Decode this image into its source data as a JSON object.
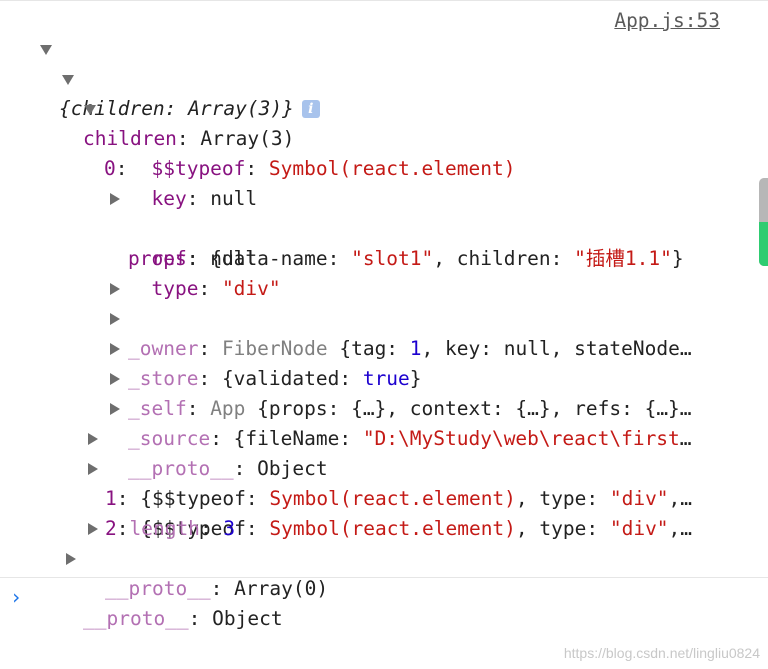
{
  "source_link": "App.js:53",
  "root": {
    "brace_open": "{",
    "key": "children",
    "sep": ": ",
    "value": "Array(3)",
    "brace_close": "}",
    "info_icon": "i"
  },
  "children_row": {
    "key": "children",
    "sep": ": ",
    "value": "Array(3)"
  },
  "item0": {
    "key": "0",
    "sep": ":"
  },
  "typeof_row": {
    "key": "$$typeof",
    "sep": ": ",
    "value": "Symbol(react.element)"
  },
  "key_row": {
    "key": "key",
    "sep": ": ",
    "value": "null"
  },
  "props_row": {
    "key": "props",
    "sep": ": ",
    "p1": "{data-name: ",
    "v1": "\"slot1\"",
    "p2": ", children: ",
    "v2": "\"插槽1.1\"",
    "p3": "}"
  },
  "ref_row": {
    "key": "ref",
    "sep": ": ",
    "value": "null"
  },
  "type_row": {
    "key": "type",
    "sep": ": ",
    "value": "\"div\""
  },
  "owner_row": {
    "key": "_owner",
    "sep": ": ",
    "cls": "FiberNode ",
    "p1": "{tag: ",
    "v1": "1",
    "p2": ", key: null, stateNode",
    "ell": "…"
  },
  "store_row": {
    "key": "_store",
    "sep": ": ",
    "p1": "{validated: ",
    "v1": "true",
    "p2": "}"
  },
  "self_row": {
    "key": "_self",
    "sep": ": ",
    "cls": "App ",
    "p1": "{props: {…}, context: {…}, refs: {…}",
    "ell": "…"
  },
  "source_row": {
    "key": "_source",
    "sep": ": ",
    "p1": "{fileName: ",
    "v1": "\"D:\\MyStudy\\web\\react\\first",
    "ell": "…"
  },
  "proto_obj_row": {
    "key": "__proto__",
    "sep": ": ",
    "value": "Object"
  },
  "item1": {
    "key": "1",
    "sep": ": ",
    "p1": "{$$typeof: ",
    "v1": "Symbol(react.element)",
    "p2": ", type: ",
    "v2": "\"div\"",
    "p3": ",",
    "ell": "…"
  },
  "item2": {
    "key": "2",
    "sep": ": ",
    "p1": "{$$typeof: ",
    "v1": "Symbol(react.element)",
    "p2": ", type: ",
    "v2": "\"div\"",
    "p3": ",",
    "ell": "…"
  },
  "length_row": {
    "key": "length",
    "sep": ": ",
    "value": "3"
  },
  "proto_arr_row": {
    "key": "__proto__",
    "sep": ": ",
    "value": "Array(0)"
  },
  "proto_root_row": {
    "key": "__proto__",
    "sep": ": ",
    "value": "Object"
  },
  "prompt_symbol": "›",
  "watermark": "https://blog.csdn.net/lingliu0824",
  "colors": {
    "key": "#881280",
    "dim_key": "#b370b3",
    "string": "#c41a16",
    "number": "#1c00cf",
    "class": "#808080",
    "prompt": "#1a73e8"
  }
}
